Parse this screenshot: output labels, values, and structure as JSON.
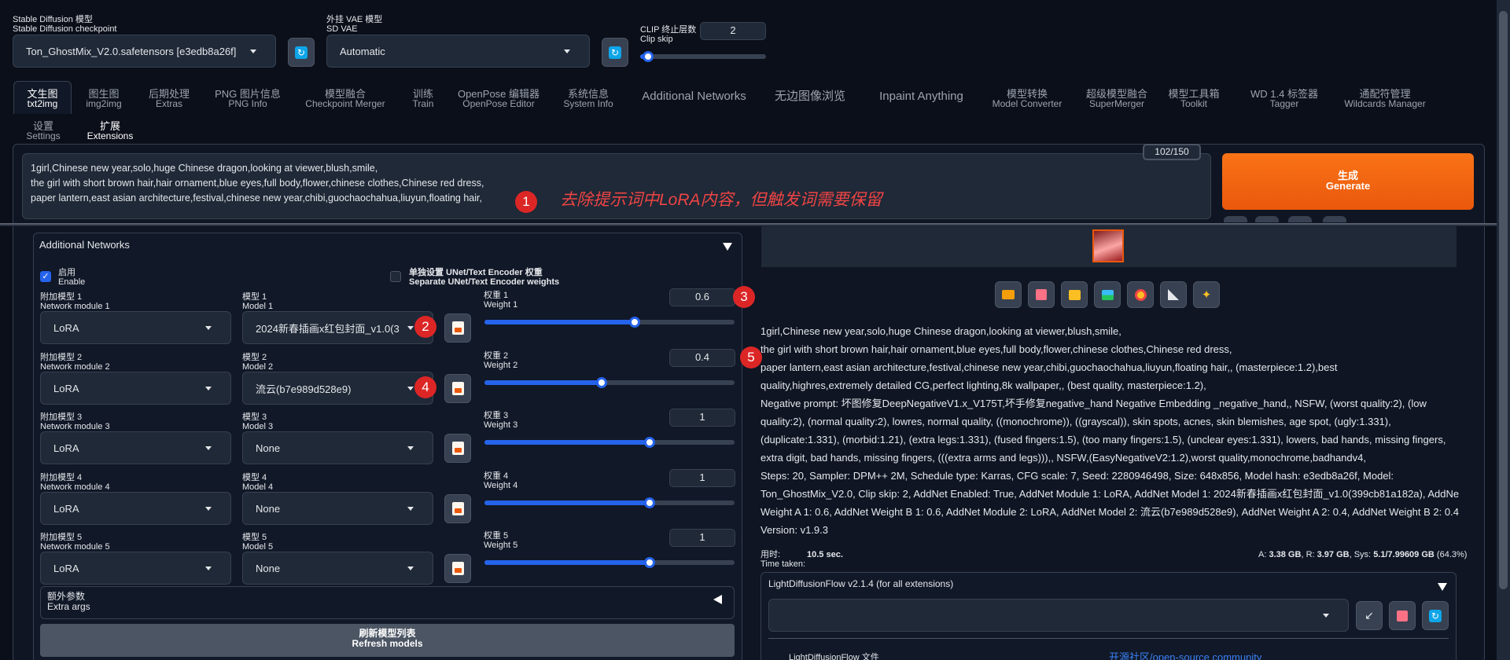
{
  "top": {
    "checkpoint_label_cn": "Stable Diffusion 模型",
    "checkpoint_label_en": "Stable Diffusion checkpoint",
    "checkpoint_value": "Ton_GhostMix_V2.0.safetensors [e3edb8a26f]",
    "vae_label_cn": "外挂 VAE 模型",
    "vae_label_en": "SD VAE",
    "vae_value": "Automatic",
    "clip_label_cn": "CLIP 终止层数",
    "clip_label_en": "Clip skip",
    "clip_value": "2",
    "clip_fraction": 0.06
  },
  "tabs": [
    {
      "cn": "文生图",
      "en": "txt2img"
    },
    {
      "cn": "图生图",
      "en": "img2img"
    },
    {
      "cn": "后期处理",
      "en": "Extras"
    },
    {
      "cn": "PNG 图片信息",
      "en": "PNG Info"
    },
    {
      "cn": "模型融合",
      "en": "Checkpoint Merger"
    },
    {
      "cn": "训练",
      "en": "Train"
    },
    {
      "cn": "OpenPose 编辑器",
      "en": "OpenPose Editor"
    },
    {
      "cn": "系统信息",
      "en": "System Info"
    },
    {
      "cn": "Additional Networks",
      "en": ""
    },
    {
      "cn": "无边图像浏览",
      "en": ""
    },
    {
      "cn": "Inpaint Anything",
      "en": ""
    },
    {
      "cn": "模型转换",
      "en": "Model Converter"
    },
    {
      "cn": "超级模型融合",
      "en": "SuperMerger"
    },
    {
      "cn": "模型工具箱",
      "en": "Toolkit"
    },
    {
      "cn": "WD 1.4 标签器",
      "en": "Tagger"
    },
    {
      "cn": "通配符管理",
      "en": "Wildcards Manager"
    },
    {
      "cn": "设置",
      "en": "Settings"
    },
    {
      "cn": "扩展",
      "en": "Extensions"
    }
  ],
  "prompt": {
    "lines": [
      "1girl,Chinese new year,solo,huge Chinese dragon,looking at viewer,blush,smile,",
      "the girl with short brown hair,hair ornament,blue eyes,full body,flower,chinese clothes,Chinese red dress,",
      "paper lantern,east asian architecture,festival,chinese new year,chibi,guochaochahua,liuyun,floating hair,"
    ],
    "token_count": "102/150",
    "annotation": "去除提示词中LoRA内容，但触发词需要保留"
  },
  "generate": {
    "cn": "生成",
    "en": "Generate"
  },
  "badges": [
    "1",
    "2",
    "3",
    "4",
    "5"
  ],
  "addnet": {
    "title": "Additional Networks",
    "enable_cn": "启用",
    "enable_en": "Enable",
    "enabled": true,
    "separate_cn": "单独设置 UNet/Text Encoder 权重",
    "separate_en": "Separate UNet/Text Encoder weights",
    "modules": [
      {
        "mod_cn": "附加模型 1",
        "mod_en": "Network module 1",
        "module": "LoRA",
        "model_cn": "模型 1",
        "model_en": "Model 1",
        "model": "2024新春插画x红包封面_v1.0(3",
        "w_cn": "权重 1",
        "w_en": "Weight 1",
        "weight": "0.6",
        "frac": 0.6
      },
      {
        "mod_cn": "附加模型 2",
        "mod_en": "Network module 2",
        "module": "LoRA",
        "model_cn": "模型 2",
        "model_en": "Model 2",
        "model": "流云(b7e989d528e9)",
        "w_cn": "权重 2",
        "w_en": "Weight 2",
        "weight": "0.4",
        "frac": 0.47
      },
      {
        "mod_cn": "附加模型 3",
        "mod_en": "Network module 3",
        "module": "LoRA",
        "model_cn": "模型 3",
        "model_en": "Model 3",
        "model": "None",
        "w_cn": "权重 3",
        "w_en": "Weight 3",
        "weight": "1",
        "frac": 0.66
      },
      {
        "mod_cn": "附加模型 4",
        "mod_en": "Network module 4",
        "module": "LoRA",
        "model_cn": "模型 4",
        "model_en": "Model 4",
        "model": "None",
        "w_cn": "权重 4",
        "w_en": "Weight 4",
        "weight": "1",
        "frac": 0.66
      },
      {
        "mod_cn": "附加模型 5",
        "mod_en": "Network module 5",
        "module": "LoRA",
        "model_cn": "模型 5",
        "model_en": "Model 5",
        "model": "None",
        "w_cn": "权重 5",
        "w_en": "Weight 5",
        "weight": "1",
        "frac": 0.66
      }
    ],
    "extra_cn": "额外参数",
    "extra_en": "Extra args",
    "refresh_cn": "刷新模型列表",
    "refresh_en": "Refresh models"
  },
  "output": {
    "info_lines": [
      "1girl,Chinese new year,solo,huge Chinese dragon,looking at viewer,blush,smile,",
      "the girl with short brown hair,hair ornament,blue eyes,full body,flower,chinese clothes,Chinese red dress,",
      "paper lantern,east asian architecture,festival,chinese new year,chibi,guochaochahua,liuyun,floating hair,, (masterpiece:1.2),best",
      "quality,highres,extremely detailed CG,perfect lighting,8k wallpaper,, (best quality, masterpiece:1.2),",
      "Negative prompt: 坏图修复DeepNegativeV1.x_V175T,坏手修复negative_hand Negative Embedding _negative_hand,, NSFW, (worst quality:2), (low",
      "quality:2), (normal quality:2), lowres, normal quality, ((monochrome)), ((grayscal)), skin spots, acnes, skin blemishes, age spot, (ugly:1.331),",
      "(duplicate:1.331), (morbid:1.21), (extra legs:1.331), (fused fingers:1.5), (too many fingers:1.5), (unclear eyes:1.331), lowers, bad hands, missing fingers,",
      "extra digit, bad hands, missing fingers, (((extra arms and legs))),, NSFW,(EasyNegativeV2:1.2),worst quality,monochrome,badhandv4,",
      "Steps: 20, Sampler: DPM++ 2M, Schedule type: Karras, CFG scale: 7, Seed: 2280946498, Size: 648x856, Model hash: e3edb8a26f, Model:",
      "Ton_GhostMix_V2.0, Clip skip: 2, AddNet Enabled: True, AddNet Module 1: LoRA, AddNet Model 1: 2024新春插画x红包封面_v1.0(399cb81a182a), AddNet",
      "Weight A 1: 0.6, AddNet Weight B 1: 0.6, AddNet Module 2: LoRA, AddNet Model 2: 流云(b7e989d528e9), AddNet Weight A 2: 0.4, AddNet Weight B 2: 0.4,",
      "Version: v1.9.3"
    ],
    "time_cn": "用时:",
    "time_en": "Time taken:",
    "time_value": "10.5 sec.",
    "mem_a_label": "A:",
    "mem_a": "3.38 GB",
    "mem_r_label": "R:",
    "mem_r": "3.97 GB",
    "mem_sys_label": "Sys:",
    "mem_sys": "5.1/7.99609 GB",
    "mem_pct": "(64.3%)",
    "ldf_title": "LightDiffusionFlow v2.1.4 (for all extensions)",
    "ldf_file": "LightDiffusionFlow 文件",
    "ldf_link": "开源社区/open-source community"
  },
  "colors": {
    "accent": "#2563eb",
    "generate": "#ea580c",
    "badge": "#dc2626",
    "annotation": "#ef4444"
  }
}
